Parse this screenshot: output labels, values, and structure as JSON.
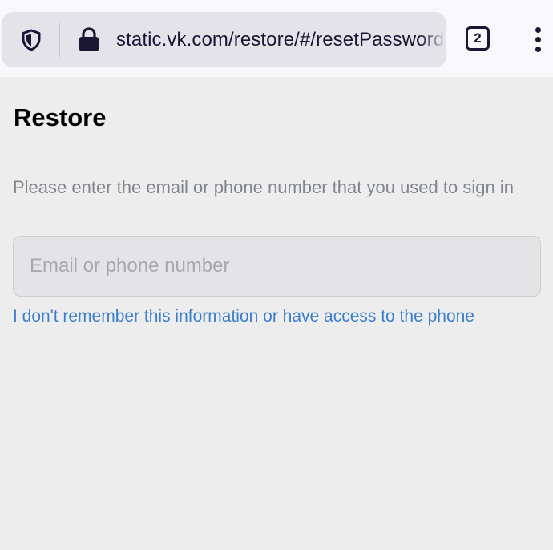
{
  "browser": {
    "url": "static.vk.com/restore/#/resetPassword",
    "tab_count": "2",
    "icons": {
      "shield": "shield-icon",
      "lock": "lock-icon",
      "menu": "more-vertical-icon"
    }
  },
  "page": {
    "title": "Restore",
    "instruction": "Please enter the email or phone number that you used to sign in",
    "input": {
      "value": "",
      "placeholder": "Email or phone number"
    },
    "help_link": "I don't remember this information or have access to the phone"
  },
  "colors": {
    "link": "#3c7fcb",
    "background": "#ededed",
    "browser_text": "#1c1635"
  }
}
